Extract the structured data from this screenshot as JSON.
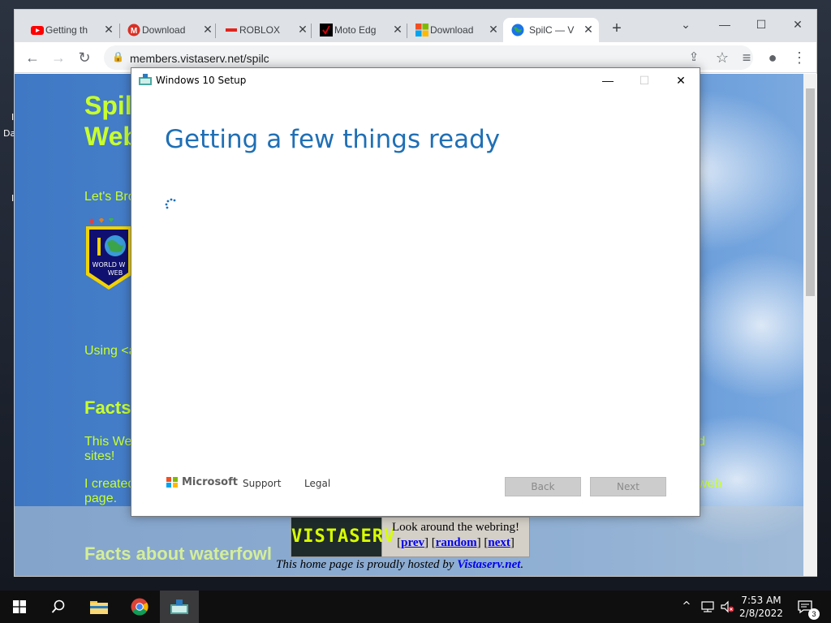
{
  "desktop": {
    "stub_glyph": "I",
    "stub_text": "Da"
  },
  "browser": {
    "tabs": [
      {
        "label": "Getting th",
        "icon": "youtube-icon",
        "color": "#ff0000"
      },
      {
        "label": "Download",
        "icon": "gmail-icon",
        "color": "#d93025"
      },
      {
        "label": "ROBLOX",
        "icon": "roblox-icon",
        "color": "#e2231a"
      },
      {
        "label": "Moto Edg",
        "icon": "verizon-icon",
        "color": "#cd040b"
      },
      {
        "label": "Download",
        "icon": "windows-logo-icon",
        "color": "#0078d4"
      },
      {
        "label": "SpilC — V",
        "icon": "globe-icon",
        "color": "#1a73e8"
      }
    ],
    "tab_close_glyph": "✕",
    "new_tab_glyph": "+",
    "controls": {
      "tab_search": "⌄",
      "minimize": "—",
      "maximize": "☐",
      "close": "✕"
    },
    "toolbar": {
      "back_glyph": "←",
      "forward_glyph": "→",
      "reload_glyph": "↻",
      "lock_glyph": "🔒",
      "share_glyph": "⇪",
      "bookmark_glyph": "☆",
      "media_glyph": "≡",
      "profile_glyph": "●",
      "menu_glyph": "⋮"
    },
    "url": "members.vistaserv.net/spilc"
  },
  "page": {
    "title_line1": "Spil",
    "title_line2": "Web",
    "lets_bro": "Let's Bro",
    "using": "Using <a",
    "facts_heading": "Facts",
    "this_we": "This We",
    "sites": "sites!",
    "i_created": "I created",
    "page_word": "page.",
    "right_d": "d",
    "right_web": "web",
    "facts_waterfowl": "Facts about waterfowl",
    "badge_text_line1": "WORLD W",
    "badge_text_line2": "WEB",
    "webring": {
      "logo": "VISTASERV",
      "line1": "Look around the webring!",
      "bracket_open": "[",
      "bracket_close": "]",
      "prev": "prev",
      "random": "random",
      "next": "next"
    },
    "hosted_prefix": "This home page is proudly hosted by ",
    "hosted_link": "Vistaserv.net",
    "hosted_suffix": "."
  },
  "dialog": {
    "title": "Windows 10 Setup",
    "controls": {
      "minimize": "—",
      "maximize": "☐",
      "close": "✕"
    },
    "heading": "Getting a few things ready",
    "brand": "Microsoft",
    "brand_colors": [
      "#f25022",
      "#7fba00",
      "#00a4ef",
      "#ffb900"
    ],
    "support": "Support",
    "legal": "Legal",
    "back": "Back",
    "next": "Next"
  },
  "taskbar": {
    "start_icon": "windows-start-icon",
    "chevron": "^",
    "notification_count": "3",
    "time": "7:53 AM",
    "date": "2/8/2022"
  }
}
